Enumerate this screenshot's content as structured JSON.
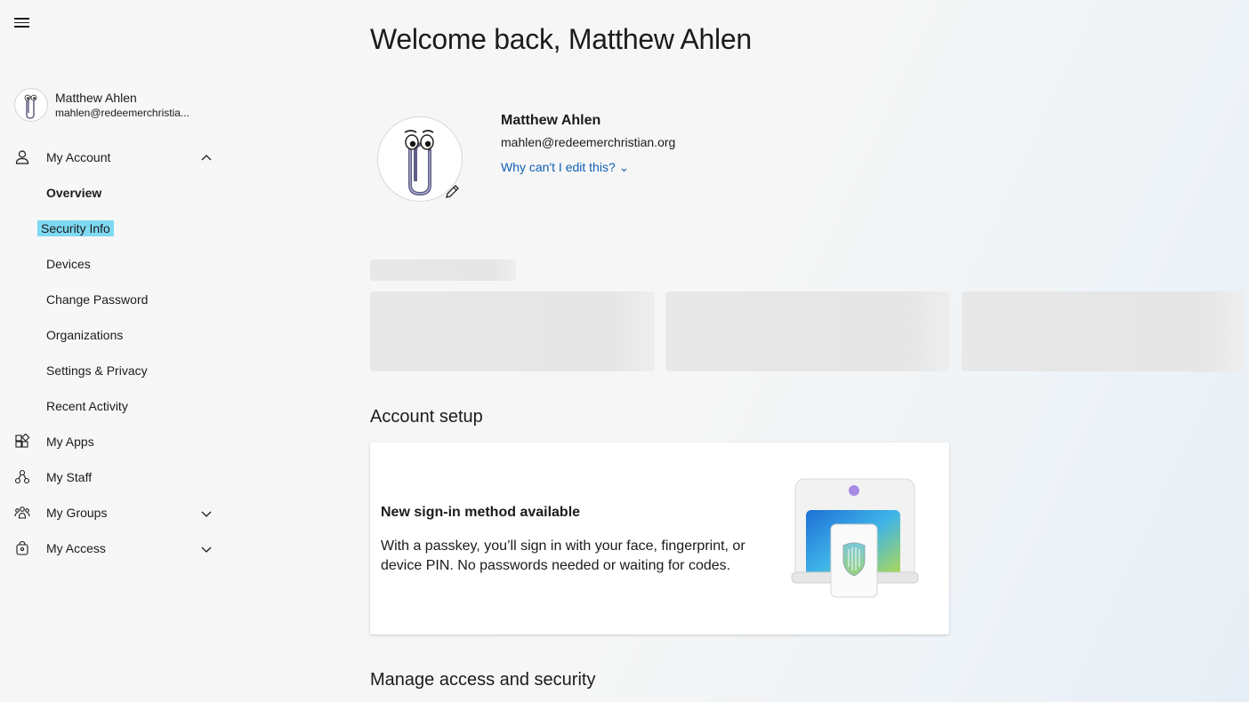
{
  "sidebar": {
    "menu_icon": "hamburger-icon",
    "user": {
      "name": "Matthew Ahlen",
      "email": "mahlen@redeemerchristia..."
    },
    "items": [
      {
        "label": "My Account",
        "icon": "person-icon",
        "expanded": true
      },
      {
        "label": "Overview"
      },
      {
        "label": "Security Info"
      },
      {
        "label": "Devices"
      },
      {
        "label": "Change Password"
      },
      {
        "label": "Organizations"
      },
      {
        "label": "Settings & Privacy"
      },
      {
        "label": "Recent Activity"
      },
      {
        "label": "My Apps",
        "icon": "apps-icon"
      },
      {
        "label": "My Staff",
        "icon": "staff-icon"
      },
      {
        "label": "My Groups",
        "icon": "groups-icon",
        "expanded": false
      },
      {
        "label": "My Access",
        "icon": "access-icon",
        "expanded": false
      }
    ],
    "highlight_color": "#7fd9f2"
  },
  "main": {
    "title": "Welcome back, Matthew Ahlen",
    "profile": {
      "name": "Matthew Ahlen",
      "email": "mahlen@redeemerchristian.org",
      "edit_link": "Why can't I edit this? ⌄"
    },
    "account_setup": {
      "heading": "Account setup",
      "card_title": "New sign-in method available",
      "card_desc": "With a passkey, you’ll sign in with your face, fingerprint, or device PIN. No passwords needed or waiting for codes."
    },
    "manage_heading": "Manage access and security",
    "link_color": "#0f5fb4"
  }
}
